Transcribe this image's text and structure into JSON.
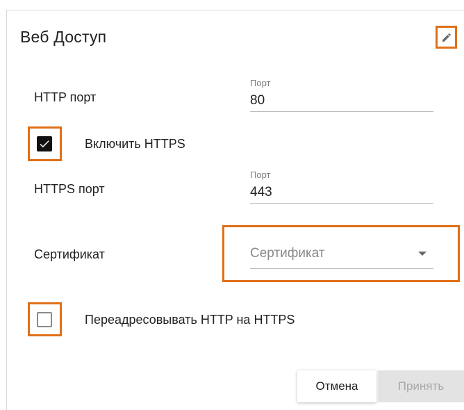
{
  "dialog": {
    "title": "Веб Доступ",
    "edit_icon": "pencil-icon"
  },
  "http": {
    "label": "HTTP порт",
    "port_label": "Порт",
    "port_value": "80"
  },
  "https_toggle": {
    "label": "Включить HTTPS",
    "checked": true
  },
  "https": {
    "label": "HTTPS порт",
    "port_label": "Порт",
    "port_value": "443"
  },
  "certificate": {
    "label": "Сертификат",
    "placeholder": "Сертификат"
  },
  "redirect": {
    "label": "Переадресовывать HTTP на HTTPS",
    "checked": false
  },
  "actions": {
    "cancel_label": "Отмена",
    "accept_label": "Принять"
  },
  "colors": {
    "highlight": "#e07017",
    "checkbox_checked": "#111111",
    "accept_disabled_bg": "#e3e3e3"
  }
}
